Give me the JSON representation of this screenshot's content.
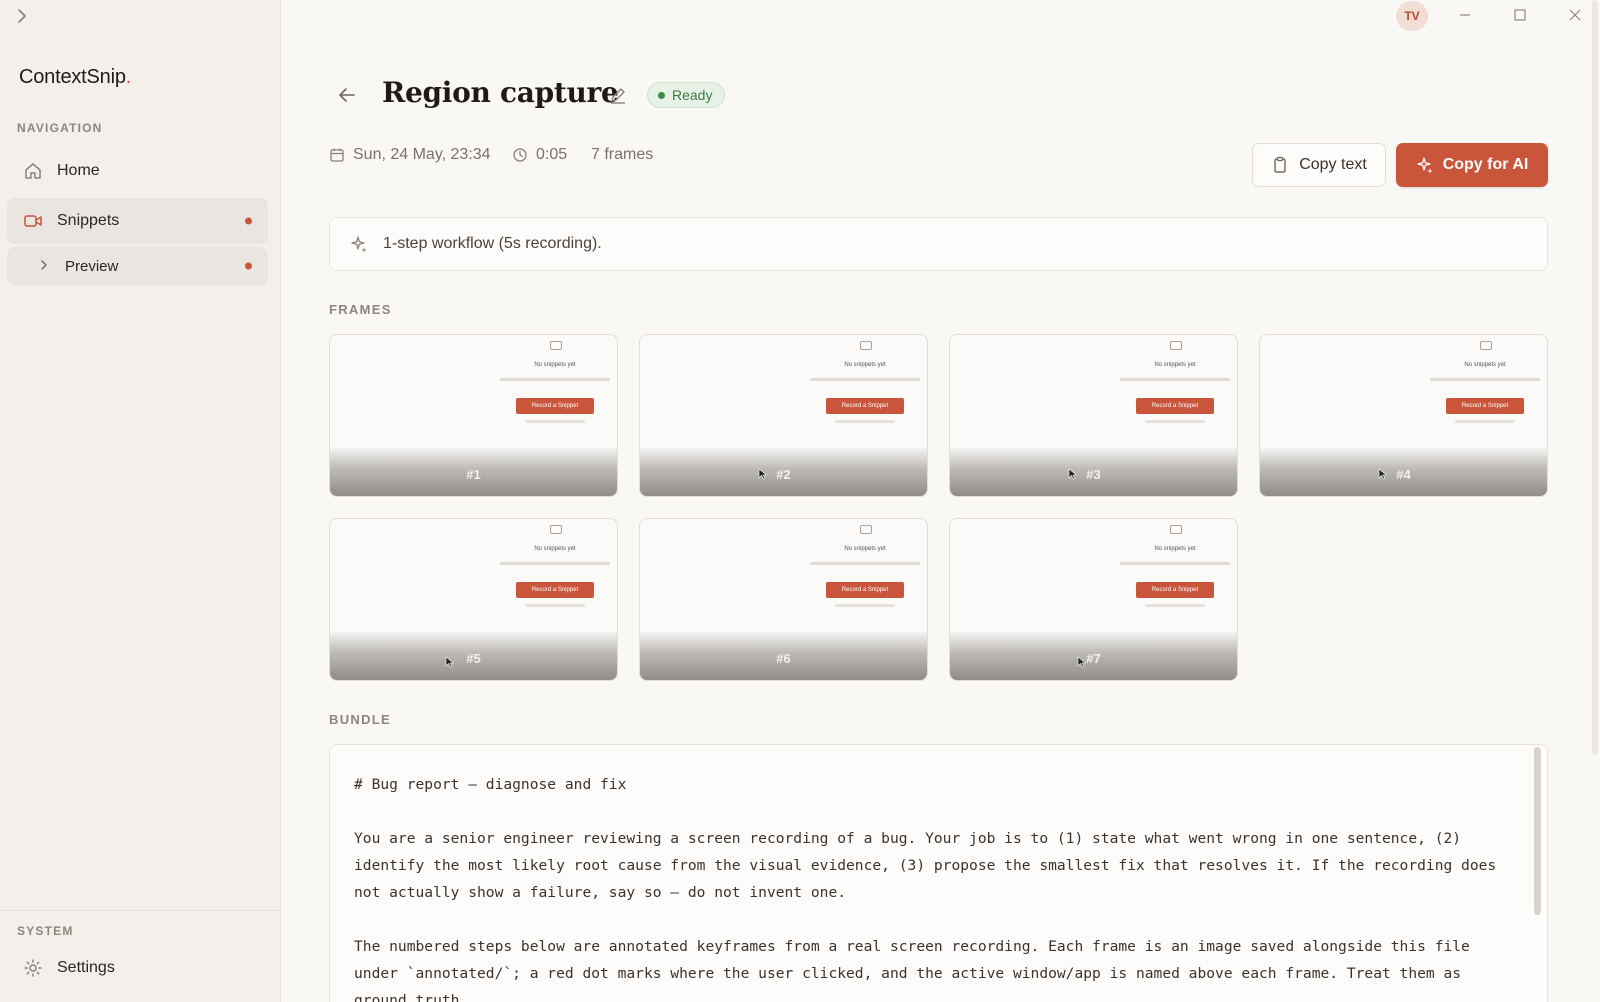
{
  "app": {
    "brand_name": "ContextSnip",
    "brand_dot": ".",
    "user_initials": "TV"
  },
  "sidebar": {
    "nav_label": "NAVIGATION",
    "items": [
      {
        "label": "Home",
        "icon": "home-icon"
      },
      {
        "label": "Snippets",
        "icon": "video-camera-icon",
        "active": true,
        "badge": true
      },
      {
        "label": "Preview",
        "icon": "chevron-right-icon",
        "sub": true,
        "badge": true
      }
    ],
    "system_label": "SYSTEM",
    "settings_label": "Settings"
  },
  "header": {
    "title": "Region capture",
    "status": "Ready",
    "date": "Sun, 24 May, 23:34",
    "duration": "0:05",
    "frames_count": "7 frames",
    "copy_text_label": "Copy text",
    "copy_ai_label": "Copy for AI"
  },
  "summary": "1-step workflow (5s recording).",
  "frames_section": {
    "label": "FRAMES",
    "frames": [
      "#1",
      "#2",
      "#3",
      "#4",
      "#5",
      "#6",
      "#7"
    ],
    "thumb_title": "No snippets yet",
    "thumb_button": "Record a Snippet"
  },
  "bundle": {
    "label": "BUNDLE",
    "content": "# Bug report — diagnose and fix\n\nYou are a senior engineer reviewing a screen recording of a bug. Your job is to (1) state what went wrong in one sentence, (2) identify the most likely root cause from the visual evidence, (3) propose the smallest fix that resolves it. If the recording does not actually show a failure, say so — do not invent one.\n\nThe numbered steps below are annotated keyframes from a real screen recording. Each frame is an image saved alongside this file under `annotated/`; a red dot marks where the user clicked, and the active window/app is named above each frame. Treat them as ground truth."
  },
  "colors": {
    "accent": "#c9553a",
    "ready_green": "#3c8a46",
    "sidebar_bg": "#f3f0ec",
    "page_bg": "#faf8f5"
  }
}
